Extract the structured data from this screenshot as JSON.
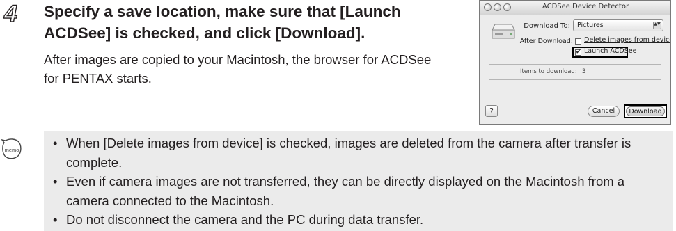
{
  "step": {
    "number": "4",
    "heading": "Specify a save location, make sure that [Launch ACDSee] is checked, and click [Download].",
    "body": "After images are copied to your Macintosh, the browser for ACDSee for PENTAX starts."
  },
  "dialog": {
    "title": "ACDSee Device Detector",
    "download_to_label": "Download To:",
    "download_to_value": "Pictures",
    "after_download_label": "After Download:",
    "delete_images_label": "Delete images from device",
    "delete_images_checked": false,
    "launch_label": "Launch ACDSee",
    "launch_checked": true,
    "checkmark": "✔",
    "items_label": "Items to download:",
    "items_value": "3",
    "help_label": "?",
    "cancel_label": "Cancel",
    "download_label": "Download",
    "popup_arrows": "▲▼"
  },
  "memo": {
    "icon_label": "memo",
    "bullet": "•",
    "items": [
      "When [Delete images from device] is checked, images are deleted from the camera after transfer is complete.",
      "Even if camera images are not transferred, they can be directly displayed on the Macintosh from a camera connected to the Macintosh.",
      "Do not disconnect the camera and the PC during data transfer."
    ]
  }
}
